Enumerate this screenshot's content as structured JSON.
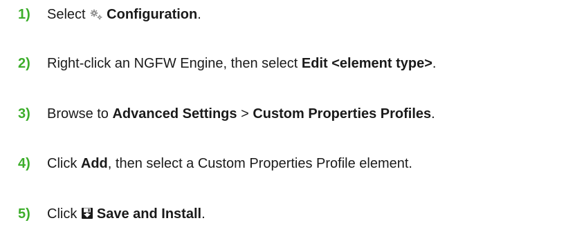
{
  "steps": [
    {
      "number": "1)",
      "before": "Select ",
      "icon": "gears-icon",
      "bold1": "Configuration",
      "after": "."
    },
    {
      "number": "2)",
      "before": "Right-click an NGFW Engine, then select ",
      "bold1": "Edit <element type>",
      "after": "."
    },
    {
      "number": "3)",
      "before": "Browse to ",
      "bold1": "Advanced Settings",
      "middle": " > ",
      "bold2": "Custom Properties Profiles",
      "after": "."
    },
    {
      "number": "4)",
      "before": "Click ",
      "bold1": "Add",
      "after": ", then select a Custom Properties Profile element."
    },
    {
      "number": "5)",
      "before": "Click ",
      "icon": "save-install-icon",
      "bold1": "Save and Install",
      "after": "."
    }
  ],
  "colors": {
    "step_number": "#3dae2b",
    "text": "#1a1a1a"
  }
}
